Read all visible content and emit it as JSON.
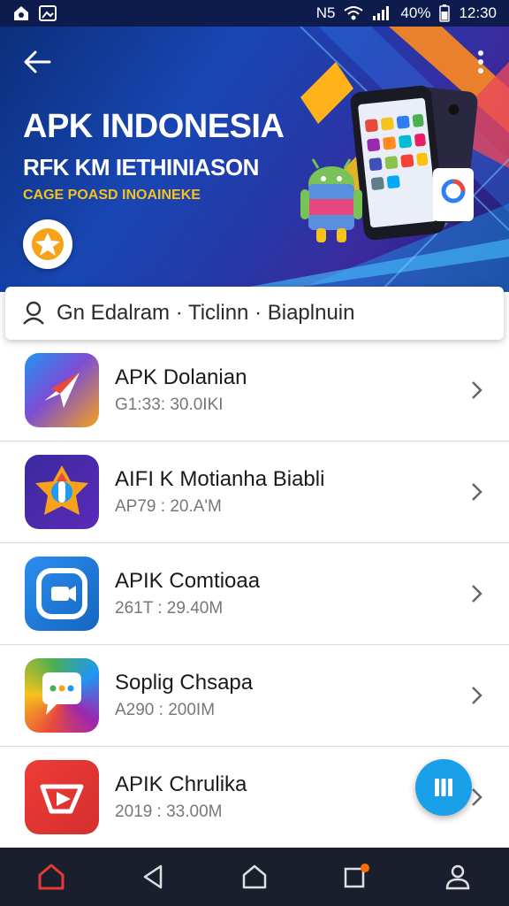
{
  "status_bar": {
    "carrier": "N5",
    "signal_text": "40%",
    "time": "12:30"
  },
  "hero": {
    "title": "APK INDONESIA",
    "subtitle": "RFK KM IETHINIASON",
    "tag": "CAGE POASD  INOAINEKE"
  },
  "search": {
    "text": "Gn Edalram · Ticlinn · Biaplnuin"
  },
  "apps": [
    {
      "name": "APK Dolanian",
      "meta": "G1:33: 30.0IKI",
      "icon": "arrow-logo-icon"
    },
    {
      "name": "AIFI K Motianha Biabli",
      "meta": "AP79 : 20.A'M",
      "icon": "puzzle-logo-icon"
    },
    {
      "name": "APIK Comtioaa",
      "meta": "261T : 29.40M",
      "icon": "video-chat-icon"
    },
    {
      "name": "Soplig Chsapa",
      "meta": "A290 : 200IM",
      "icon": "chat-bubble-icon"
    },
    {
      "name": "APIK Chrulika",
      "meta": "2019 : 33.00M",
      "icon": "play-logo-icon"
    }
  ],
  "colors": {
    "accent": "#1aa0e8",
    "nav_active": "#e53935",
    "hero_gold": "#f6c21b"
  }
}
